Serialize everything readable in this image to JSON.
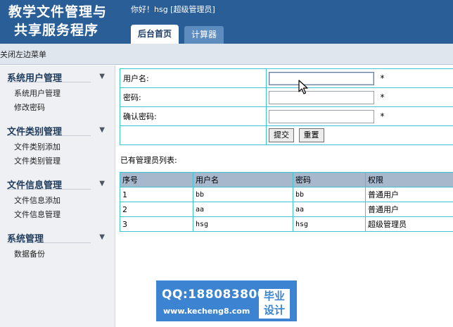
{
  "header": {
    "title_line1": "教学文件管理与",
    "title_line2": "共享服务程序",
    "welcome": "你好！hsg [超级管理员]",
    "tabs": [
      {
        "label": "后台首页",
        "active": true
      },
      {
        "label": "计算器",
        "active": false
      }
    ]
  },
  "toolbar": {
    "close_menu_label": "关闭左边菜单"
  },
  "sidebar": {
    "groups": [
      {
        "title": "系统用户管理",
        "items": [
          "系统用户管理",
          "修改密码"
        ]
      },
      {
        "title": "文件类别管理",
        "items": [
          "文件类别添加",
          "文件类别管理"
        ]
      },
      {
        "title": "文件信息管理",
        "items": [
          "文件信息添加",
          "文件信息管理"
        ]
      },
      {
        "title": "系统管理",
        "items": [
          "数据备份"
        ]
      }
    ]
  },
  "form": {
    "username_label": "用户名:",
    "username_value": "",
    "password_label": "密码:",
    "password_value": "",
    "confirm_label": "确认密码:",
    "confirm_value": "",
    "required_mark": "*",
    "submit_label": "提交",
    "reset_label": "重置"
  },
  "admin_list": {
    "title": "已有管理员列表:",
    "columns": [
      "序号",
      "用户名",
      "密码",
      "权限"
    ],
    "rows": [
      [
        "1",
        "bb",
        "bb",
        "普通用户"
      ],
      [
        "2",
        "aa",
        "aa",
        "普通用户"
      ],
      [
        "3",
        "hsg",
        "hsg",
        "超级管理员"
      ]
    ]
  },
  "watermark": {
    "qq": "QQ:188083800",
    "url": "www.kecheng8.com",
    "badge_line1": "毕业",
    "badge_line2": "设计"
  },
  "colors": {
    "header_bg": "#2a5e96",
    "table_border": "#40c4d2",
    "table_header_bg": "#a7b7cc",
    "watermark_bg": "#3c84d1"
  }
}
